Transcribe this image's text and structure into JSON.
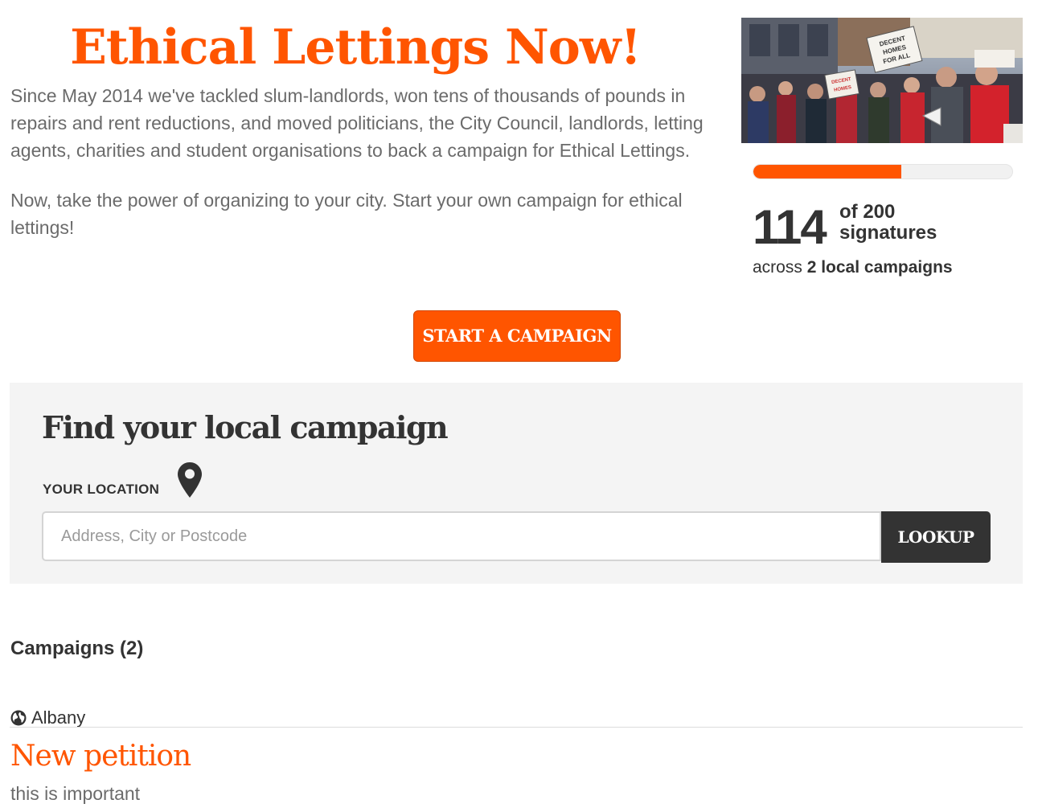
{
  "header": {
    "title": "Ethical Lettings Now!",
    "intro_paragraphs": [
      "Since May 2014 we've tackled slum-landlords, won tens of thousands of pounds in repairs and rent reductions, and moved politicians, the City Council, landlords, letting agents, charities and student organisations to back a campaign for Ethical Lettings.",
      "Now, take the power of organizing to your city. Start your own campaign for ethical lettings!"
    ]
  },
  "photo": {
    "signs": [
      "DECENT HOMES FOR ALL",
      "DECENT HOMES"
    ]
  },
  "stats": {
    "progress_fraction": 0.57,
    "signature_count": "114",
    "goal_line1": "of 200",
    "goal_line2": "signatures",
    "across_prefix": "across ",
    "across_count": "2 local campaigns"
  },
  "actions": {
    "start_campaign_label": "START A CAMPAIGN"
  },
  "finder": {
    "title": "Find your local campaign",
    "location_label": "YOUR LOCATION",
    "input_value": "",
    "input_placeholder": "Address, City or Postcode",
    "lookup_label": "LOOKUP"
  },
  "campaigns": {
    "heading": "Campaigns (2)",
    "items": [
      {
        "location": "Albany",
        "title": "New petition",
        "description": "this is important"
      }
    ]
  },
  "colors": {
    "accent": "#ff5500",
    "dark": "#333333",
    "muted_text": "#6b6b6b",
    "panel_bg": "#f4f4f4"
  },
  "icons": [
    "map-pin-icon",
    "globe-icon"
  ]
}
